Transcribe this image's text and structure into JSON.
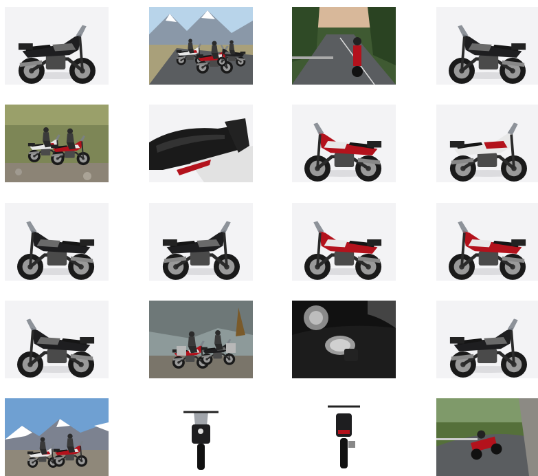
{
  "gallery": {
    "thumbnails": [
      {
        "id": "t1",
        "scene": "studio",
        "bike": "black",
        "facing": "right"
      },
      {
        "id": "t2",
        "scene": "mountain-road-group",
        "bike": "red"
      },
      {
        "id": "t3",
        "scene": "forest-road-rider",
        "bike": "red"
      },
      {
        "id": "t4",
        "scene": "studio",
        "bike": "black",
        "facing": "left"
      },
      {
        "id": "t5",
        "scene": "offroad-riders",
        "bike": "white-red"
      },
      {
        "id": "t6",
        "scene": "seat-closeup"
      },
      {
        "id": "t7",
        "scene": "studio",
        "bike": "red",
        "facing": "left"
      },
      {
        "id": "t8",
        "scene": "studio",
        "bike": "white",
        "facing": "right"
      },
      {
        "id": "t9",
        "scene": "studio",
        "bike": "black",
        "facing": "left"
      },
      {
        "id": "t10",
        "scene": "studio",
        "bike": "black",
        "facing": "right"
      },
      {
        "id": "t11",
        "scene": "studio",
        "bike": "red",
        "facing": "left"
      },
      {
        "id": "t12",
        "scene": "studio",
        "bike": "red",
        "facing": "left"
      },
      {
        "id": "t13",
        "scene": "studio",
        "bike": "black",
        "facing": "left"
      },
      {
        "id": "t14",
        "scene": "rocky-riders",
        "bike": "red"
      },
      {
        "id": "t15",
        "scene": "fuel-cap-closeup"
      },
      {
        "id": "t16",
        "scene": "studio",
        "bike": "black",
        "facing": "right"
      },
      {
        "id": "t17",
        "scene": "snowy-mountains-riders",
        "bike": "red"
      },
      {
        "id": "t18",
        "scene": "front-view",
        "bike": "black"
      },
      {
        "id": "t19",
        "scene": "rear-view",
        "bike": "black"
      },
      {
        "id": "t20",
        "scene": "curvy-road-rider",
        "bike": "red"
      }
    ]
  },
  "colors": {
    "background": "#ffffff",
    "studio": "#f3f3f5",
    "bike_black": "#1e1e20",
    "bike_red": "#b3121c",
    "bike_white": "#e8e8e8",
    "wheel": "#1a1a1a",
    "road": "#5a5d60",
    "grass": "#6f7a3a",
    "sky": "#b8d4ea"
  }
}
